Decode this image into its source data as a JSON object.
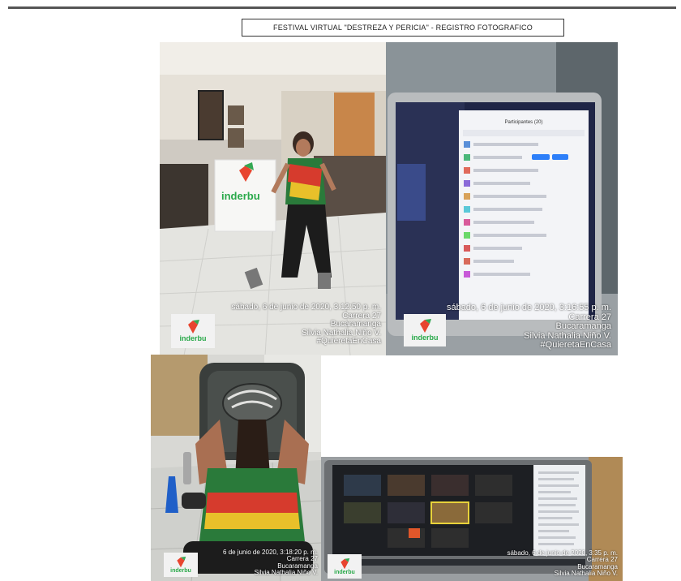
{
  "document": {
    "title": "FESTIVAL VIRTUAL \"DESTREZA Y PERICIA\" - REGISTRO FOTOGRAFICO"
  },
  "photos": [
    {
      "timestamp": "sábado, 6 de junio de 2020, 3:12:50 p. m.",
      "address": "Carrera 27",
      "city": "Bucaramanga",
      "person": "Silvia Nathalia Niño V.",
      "hashtag": "#QuieretaEnCasa",
      "logo": "inderbu",
      "banner_text": "inderbu"
    },
    {
      "timestamp": "sábado, 6 de junio de 2020, 3:16:55 p. m.",
      "address": "Carrera 27",
      "city": "Bucaramanga",
      "person": "Silvia Nathalia Niño V.",
      "hashtag": "#QuieretaEnCasa",
      "logo": "inderbu",
      "screen_header": "Participantes (20)"
    },
    {
      "timestamp": "6 de junio de 2020, 3:18:20 p. m.",
      "address": "Carrera 27",
      "city": "Bucaramanga",
      "person": "Silvia Nathalia Niño V.",
      "logo": "inderbu"
    },
    {
      "timestamp": "sábado, 6 de junio de 2020, 3:35 p. m.",
      "address": "Carrera 27",
      "city": "Bucaramanga",
      "person": "Silvia Nathalia Niño V.",
      "logo": "inderbu"
    }
  ]
}
